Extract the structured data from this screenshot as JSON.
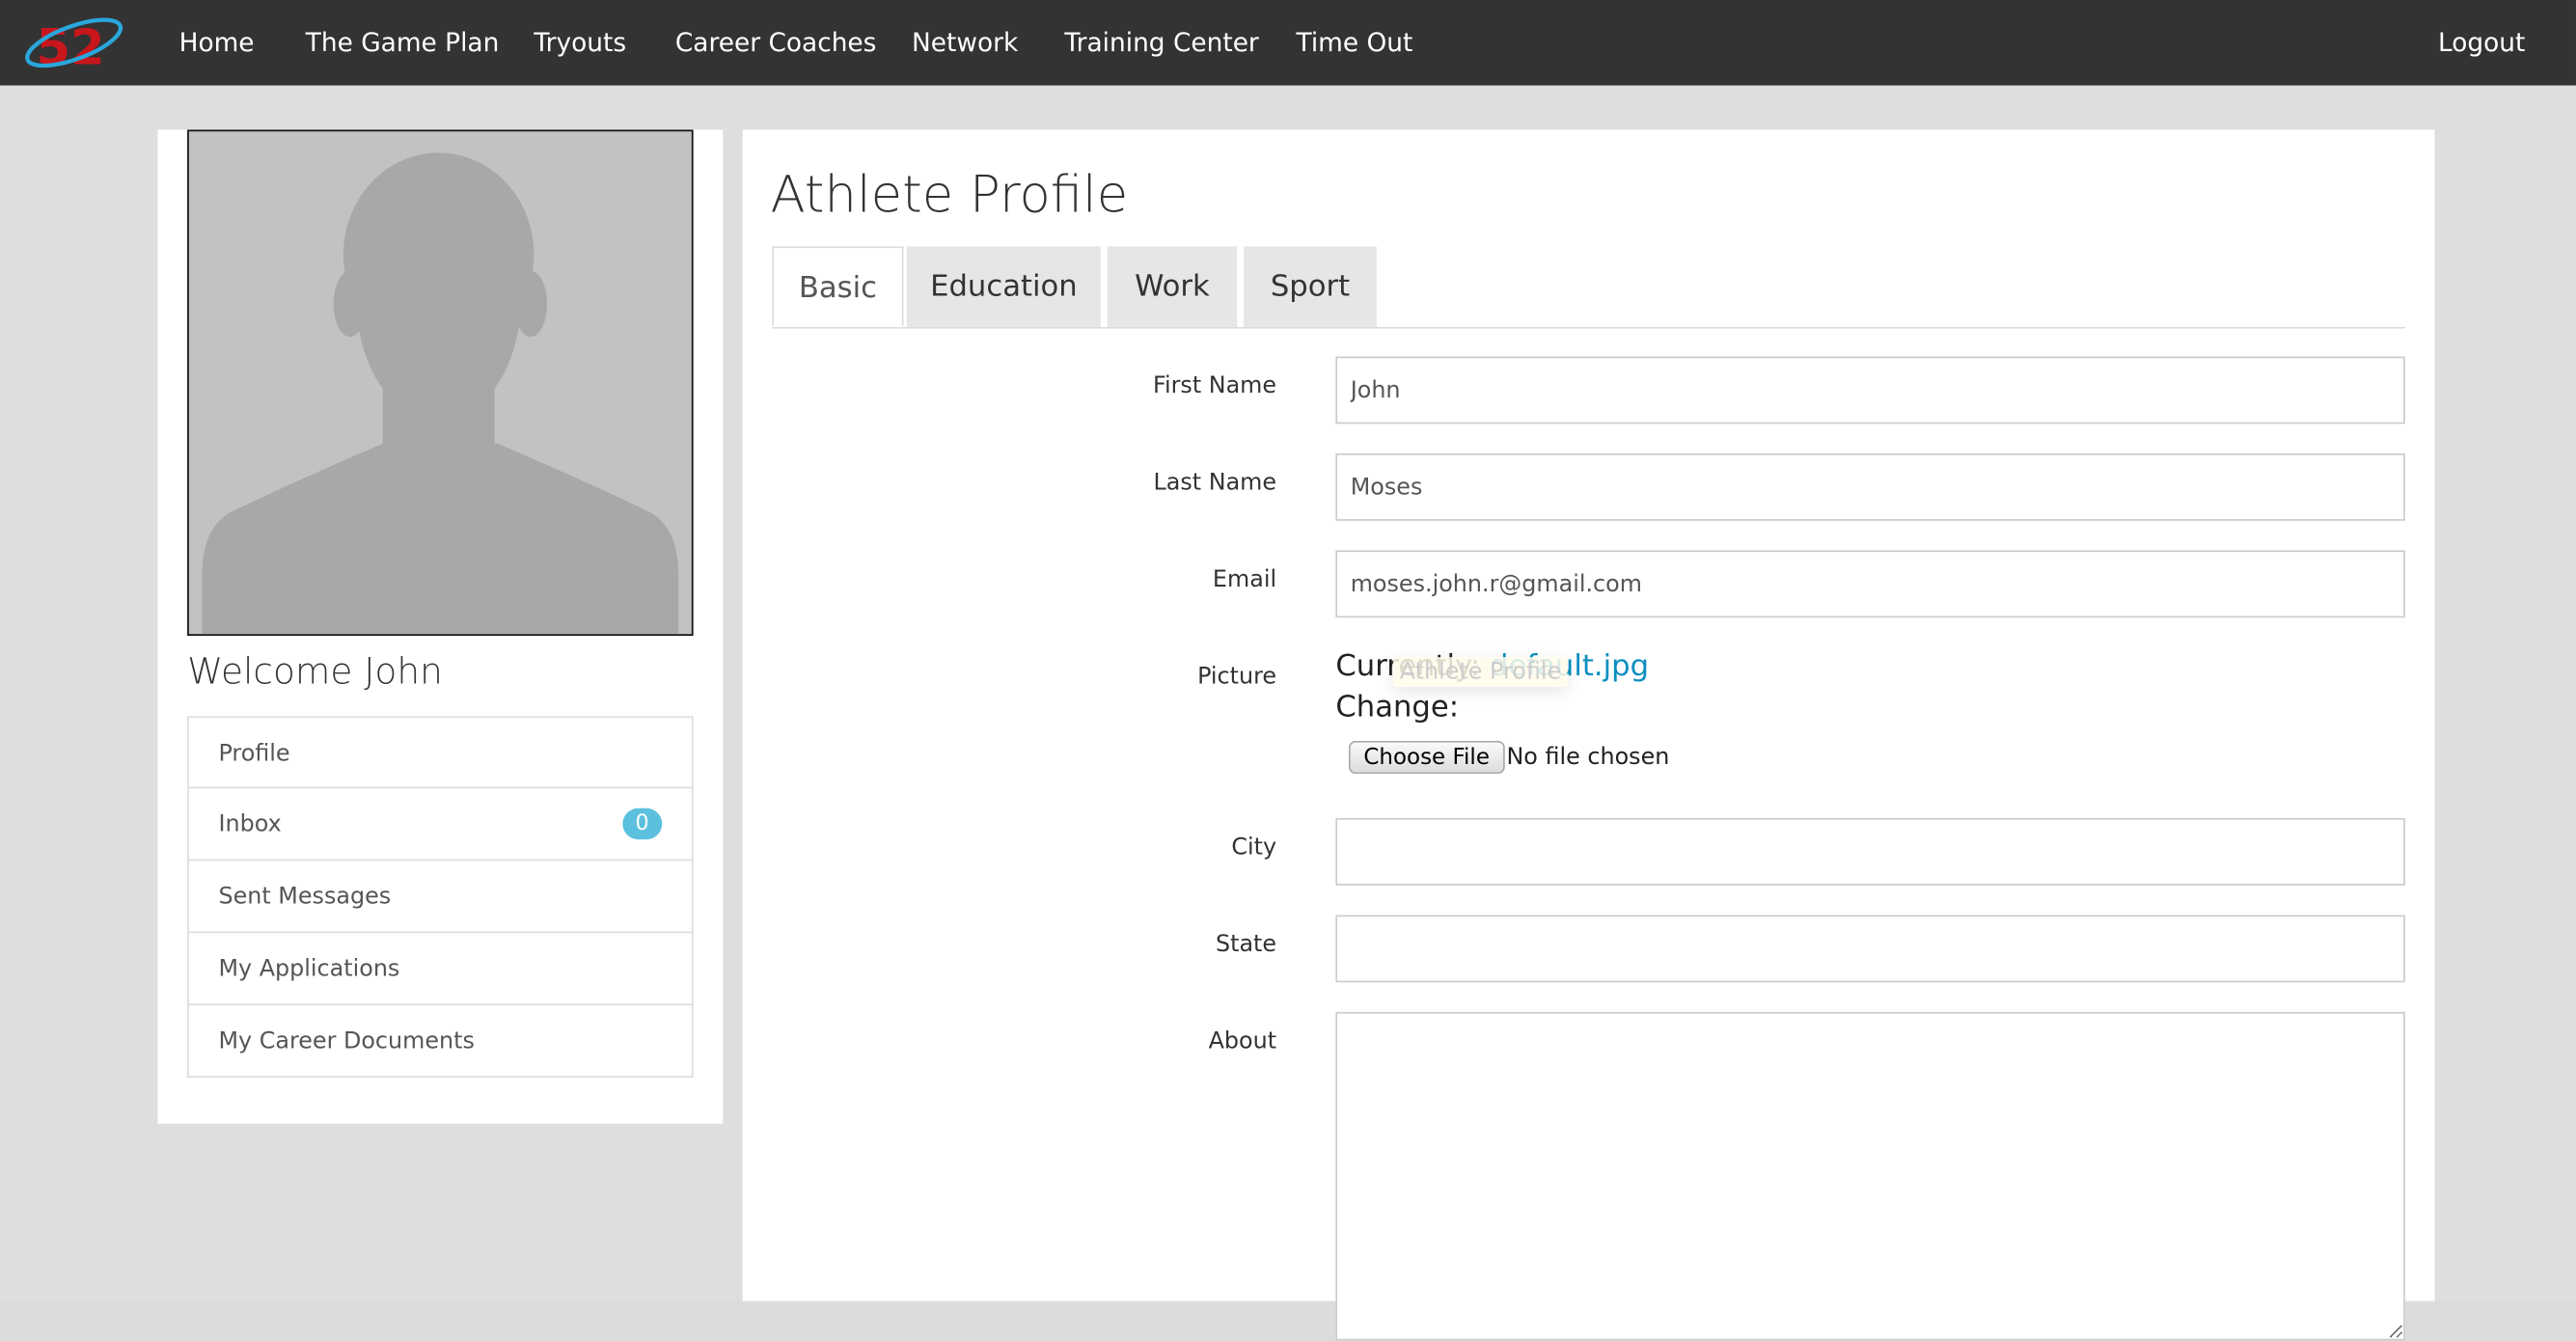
{
  "nav": {
    "logo_text": "52",
    "items": [
      "Home",
      "The Game Plan",
      "Tryouts",
      "Career Coaches",
      "Network",
      "Training Center",
      "Time Out"
    ],
    "logout": "Logout"
  },
  "sidebar": {
    "welcome": "Welcome John",
    "items": [
      {
        "label": "Profile"
      },
      {
        "label": "Inbox",
        "badge": "0"
      },
      {
        "label": "Sent Messages"
      },
      {
        "label": "My Applications"
      },
      {
        "label": "My Career Documents"
      }
    ]
  },
  "main": {
    "title": "Athlete Profile",
    "tabs": [
      "Basic",
      "Education",
      "Work",
      "Sport"
    ],
    "active_tab": "Basic",
    "form": {
      "first_name_label": "First Name",
      "first_name": "John",
      "last_name_label": "Last Name",
      "last_name": "Moses",
      "email_label": "Email",
      "email": "moses.john.r@gmail.com",
      "picture_label": "Picture",
      "currently": "Currently:",
      "current_file": "default.jpg",
      "change": "Change:",
      "choose_file": "Choose File",
      "no_file": "No file chosen",
      "city_label": "City",
      "city": "",
      "state_label": "State",
      "state": "",
      "about_label": "About",
      "about": ""
    },
    "tooltip": "Athlete Profile"
  },
  "colors": {
    "navbar": "#333333",
    "link": "#0a8ec0",
    "badge": "#5bc0de"
  }
}
